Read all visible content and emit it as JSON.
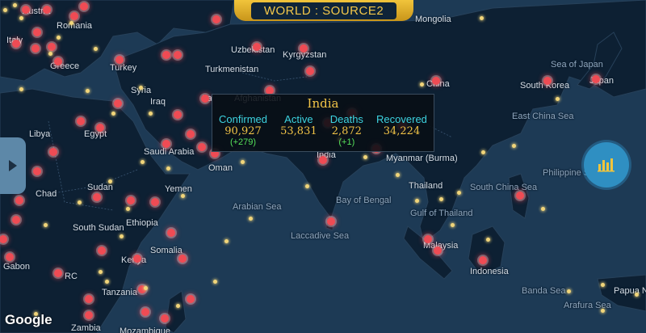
{
  "banner": {
    "title": "WORLD : SOURCE2"
  },
  "tooltip": {
    "country": "India",
    "columns": [
      {
        "header": "Confirmed",
        "value": "90,927",
        "delta": "(+279)"
      },
      {
        "header": "Active",
        "value": "53,831",
        "delta": ""
      },
      {
        "header": "Deaths",
        "value": "2,872",
        "delta": "(+1)"
      },
      {
        "header": "Recovered",
        "value": "34,224",
        "delta": ""
      }
    ]
  },
  "labels": [
    "Austria",
    "Romania",
    "Italy",
    "Greece",
    "Turkey",
    "Syria",
    "Iraq",
    "Egypt",
    "Libya",
    "Saudi Arabia",
    "Oman",
    "Yemen",
    "Sudan",
    "Chad",
    "South Sudan",
    "Ethiopia",
    "Somalia",
    "Kenya",
    "Tanzania",
    "Gabon",
    "RC",
    "Zambia",
    "Mozambique",
    "Uzbekistan",
    "Kyrgyzstan",
    "Turkmenistan",
    "Mongolia",
    "China",
    "India",
    "Myanmar (Burma)",
    "Thailand",
    "Malaysia",
    "Indonesia",
    "Japan",
    "South Korea",
    "Papua New Guinea",
    "Ira",
    "Afghanistan"
  ],
  "seas": [
    "Sea of Japan",
    "East China Sea",
    "Philippine Sea",
    "South China Sea",
    "Bay of Bengal",
    "Arabian Sea",
    "Laccadive Sea",
    "Gulf of Thailand",
    "Banda Sea",
    "Arafura Sea"
  ],
  "attribution": "Google",
  "icons": {
    "side_toggle": "chevron-right-icon",
    "fab": "bar-chart-icon"
  },
  "colors": {
    "case_marker": "#ef4b54",
    "small_marker": "#f1d57a",
    "banner": "#f1c43b",
    "fab": "#2f8fc2"
  }
}
